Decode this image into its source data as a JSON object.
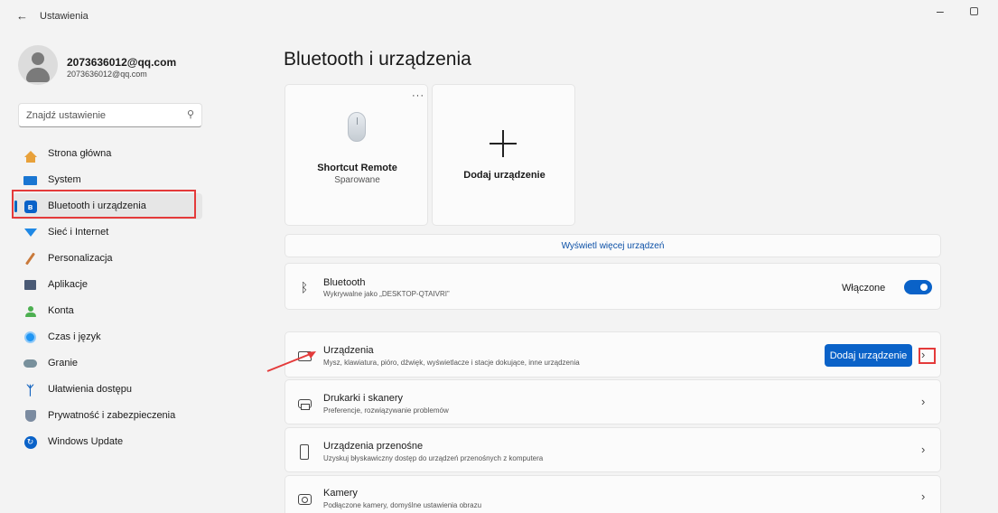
{
  "window": {
    "title": "Ustawienia",
    "back": "←",
    "minimize": "–"
  },
  "profile": {
    "name": "2073636012@qq.com",
    "email": "2073636012@qq.com"
  },
  "search": {
    "placeholder": "Znajdź ustawienie",
    "icon": "search-icon"
  },
  "sidebar": {
    "items": [
      {
        "label": "Strona główna",
        "icon": "home-icon"
      },
      {
        "label": "System",
        "icon": "system-icon"
      },
      {
        "label": "Bluetooth i urządzenia",
        "icon": "bluetooth-icon",
        "active": true
      },
      {
        "label": "Sieć i Internet",
        "icon": "wifi-icon"
      },
      {
        "label": "Personalizacja",
        "icon": "pen-icon"
      },
      {
        "label": "Aplikacje",
        "icon": "apps-icon"
      },
      {
        "label": "Konta",
        "icon": "user-icon"
      },
      {
        "label": "Czas i język",
        "icon": "clock-icon"
      },
      {
        "label": "Granie",
        "icon": "gamepad-icon"
      },
      {
        "label": "Ułatwienia dostępu",
        "icon": "accessibility-icon"
      },
      {
        "label": "Prywatność i zabezpieczenia",
        "icon": "shield-icon"
      },
      {
        "label": "Windows Update",
        "icon": "update-icon"
      }
    ]
  },
  "main": {
    "title": "Bluetooth i urządzenia",
    "device_card": {
      "name": "Shortcut Remote",
      "status": "Sparowane",
      "more": "···"
    },
    "add_card": {
      "label": "Dodaj urządzenie"
    },
    "more_devices": "Wyświetl więcej urządzeń",
    "bluetooth": {
      "title": "Bluetooth",
      "subtitle": "Wykrywalne jako „DESKTOP-QTAIVRI”",
      "state_label": "Włączone",
      "on": true
    },
    "rows": {
      "devices": {
        "title": "Urządzenia",
        "subtitle": "Mysz, klawiatura, pióro, dźwięk, wyświetlacze i stacje dokujące, inne urządzenia",
        "button": "Dodaj urządzenie"
      },
      "printers": {
        "title": "Drukarki i skanery",
        "subtitle": "Preferencje, rozwiązywanie problemów"
      },
      "portable": {
        "title": "Urządzenia przenośne",
        "subtitle": "Uzyskuj błyskawiczny dostęp do urządzeń przenośnych z komputera"
      },
      "cameras": {
        "title": "Kamery",
        "subtitle": "Podłączone kamery, domyślne ustawienia obrazu"
      }
    },
    "chevron": "›"
  },
  "colors": {
    "accent": "#0a62c8",
    "annotation": "#e43a3a",
    "background": "#f3f3f3"
  }
}
